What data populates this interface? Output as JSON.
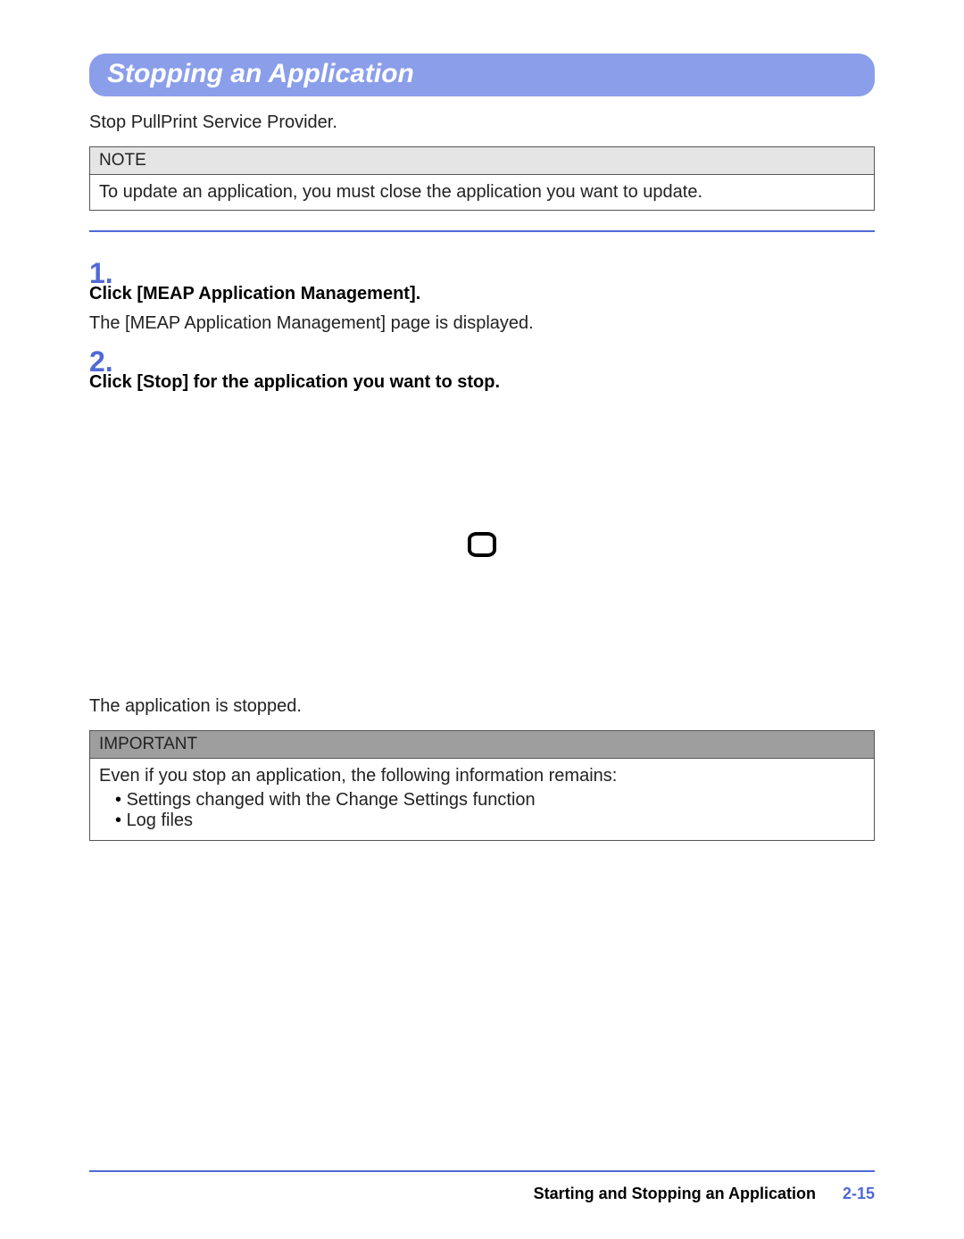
{
  "header": {
    "title": "Stopping an Application"
  },
  "intro": "Stop PullPrint Service Provider.",
  "note": {
    "label": "NOTE",
    "body": "To update an application, you must close the application you want to update."
  },
  "steps": [
    {
      "number": "1.",
      "title": "Click [MEAP Application Management].",
      "desc": "The [MEAP Application Management] page is displayed."
    },
    {
      "number": "2.",
      "title": "Click [Stop] for the application you want to stop.",
      "desc": ""
    }
  ],
  "result": "The application is stopped.",
  "important": {
    "label": "IMPORTANT",
    "intro": "Even if you stop an application, the following information remains:",
    "items": [
      "Settings changed with the Change Settings function",
      "Log files"
    ]
  },
  "footer": {
    "section": "Starting and Stopping an Application",
    "page": "2-15"
  }
}
